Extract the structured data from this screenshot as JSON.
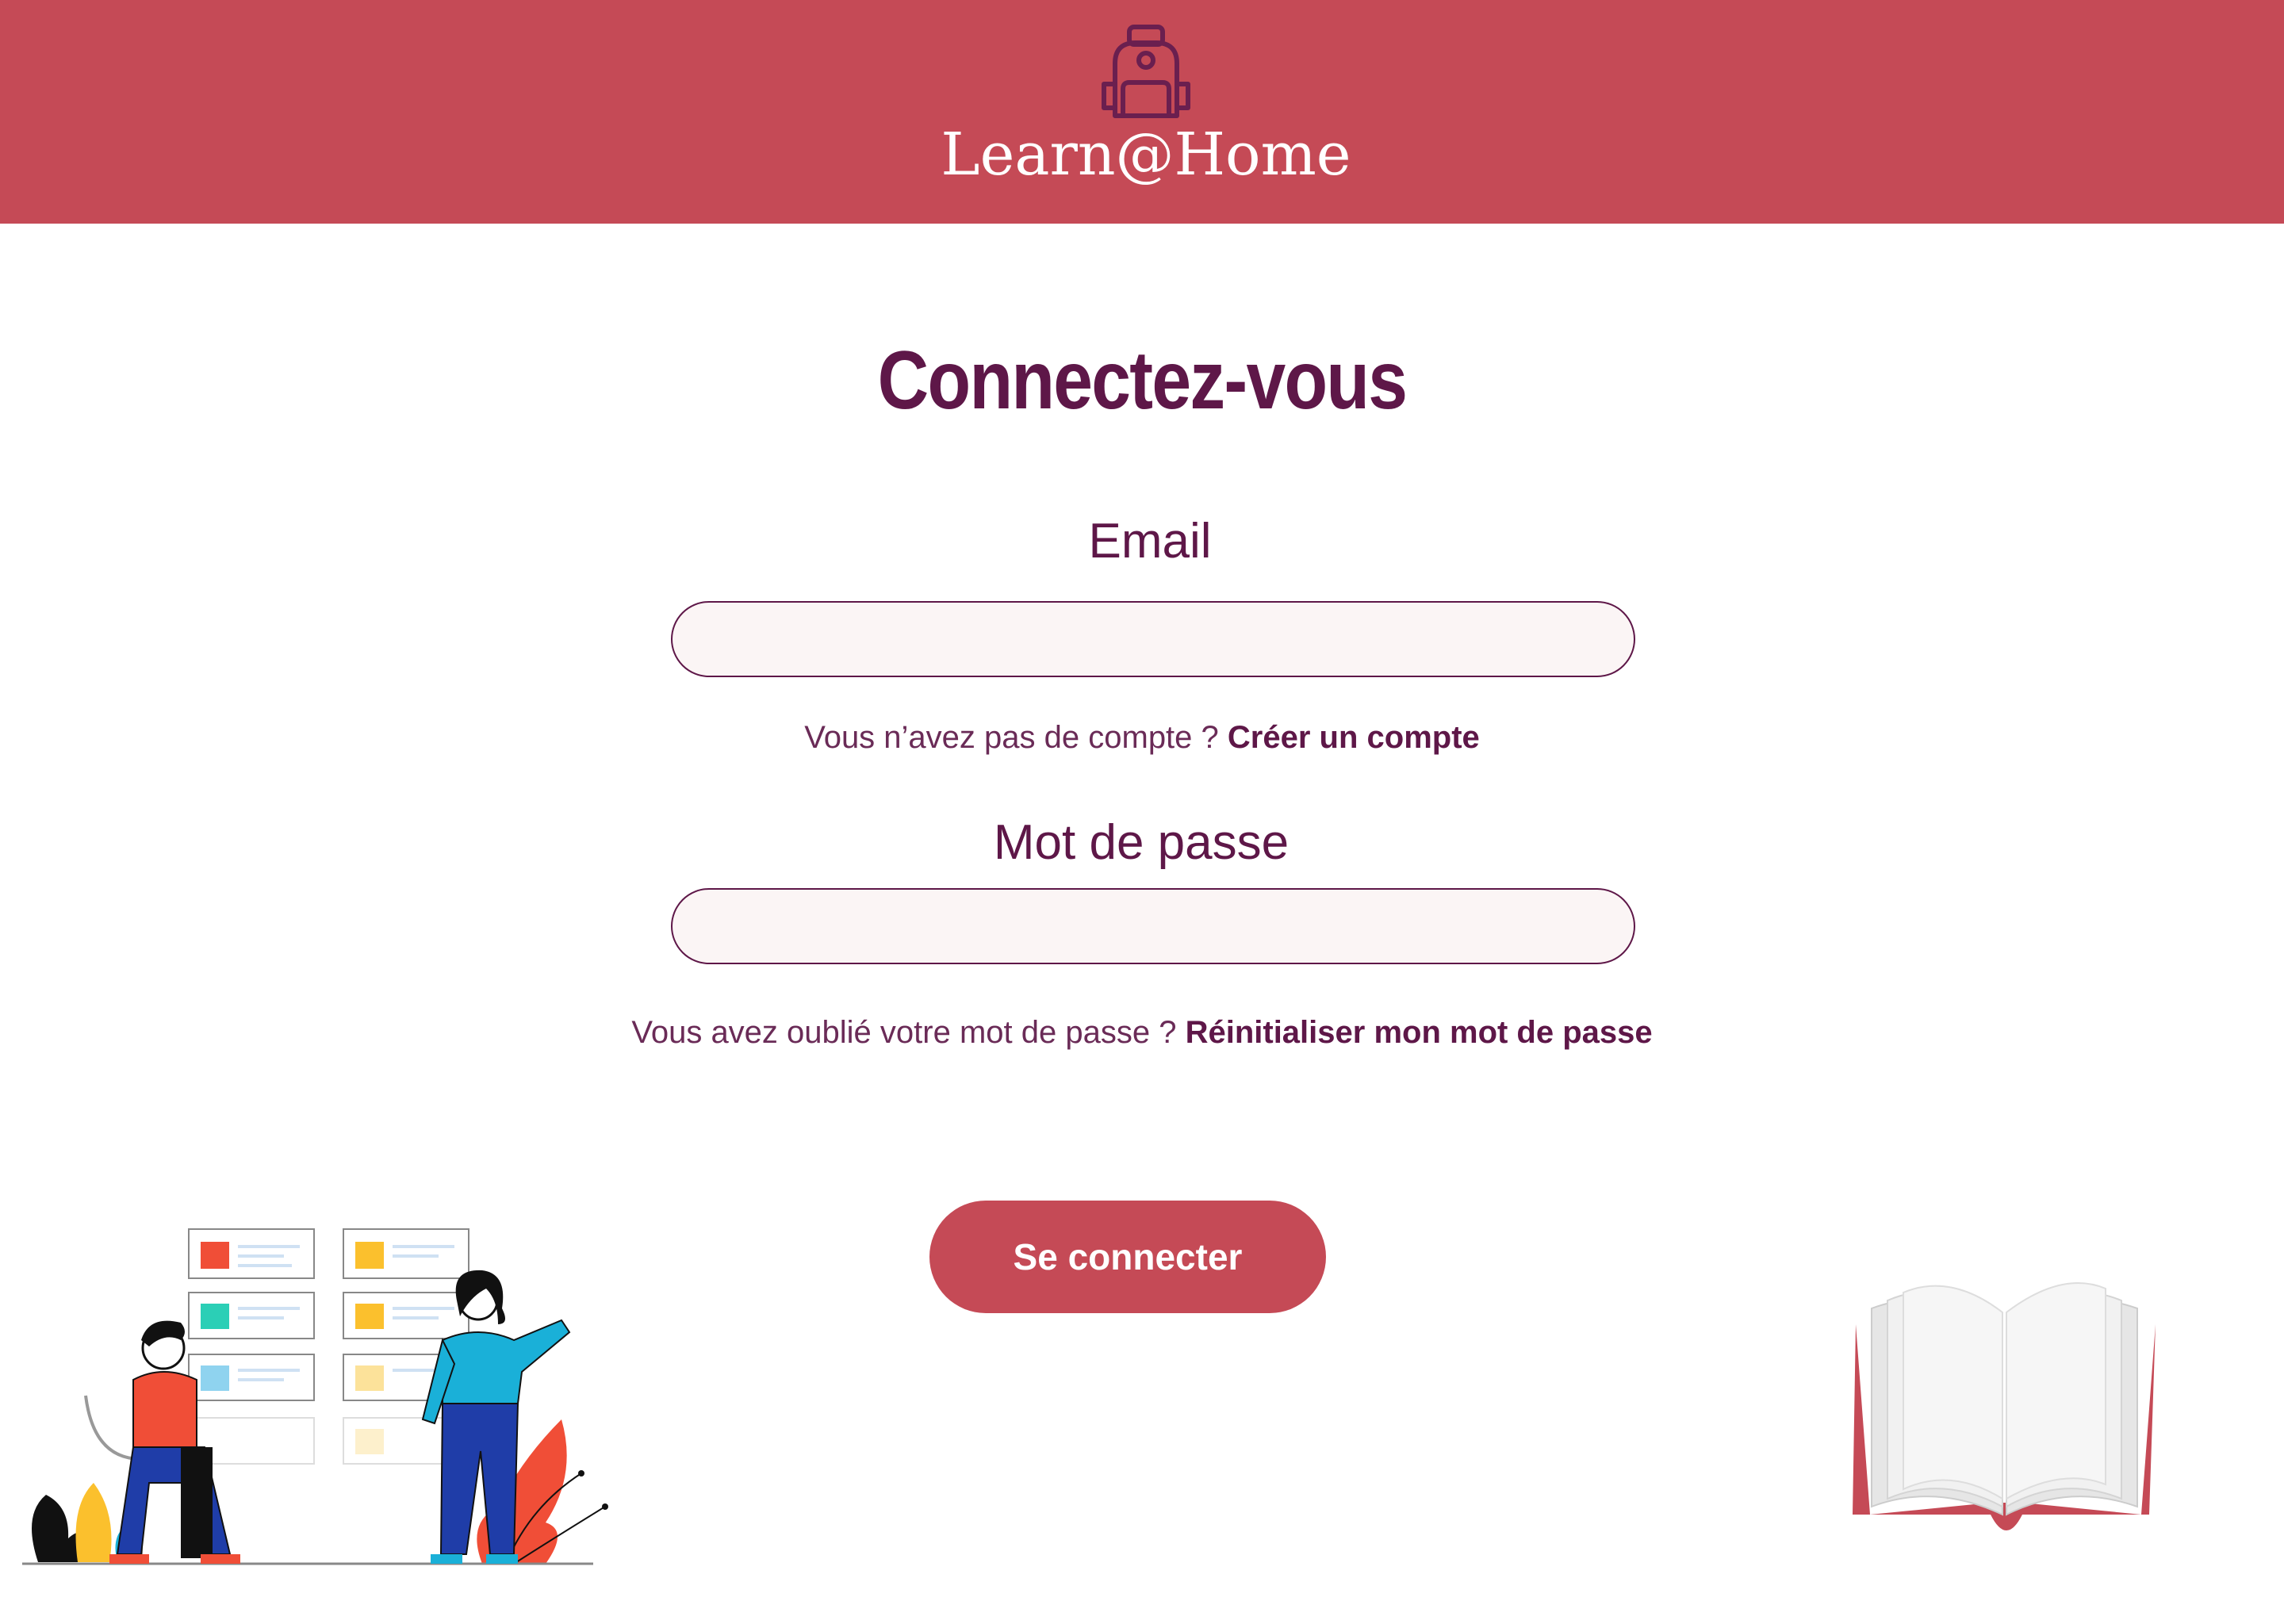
{
  "header": {
    "app_title": "Learn@Home",
    "logo_icon": "backpack-icon",
    "background_color": "#c54a56"
  },
  "login": {
    "title": "Connectez-vous",
    "email": {
      "label": "Email",
      "value": "",
      "placeholder": ""
    },
    "signup_prompt": {
      "text": "Vous n’avez pas de compte ?",
      "link": "Créer un compte"
    },
    "password": {
      "label": "Mot de passe",
      "value": "",
      "placeholder": ""
    },
    "reset_prompt": {
      "text": "Vous avez oublié votre mot de passe ?",
      "link": "Réinitialiser mon mot de passe"
    },
    "submit_label": "Se connecter"
  },
  "illustrations": {
    "left": "people-at-board-illustration",
    "right": "open-book-illustration"
  },
  "colors": {
    "primary": "#c54a56",
    "text": "#5e1748",
    "input_bg": "#fbf5f5"
  }
}
